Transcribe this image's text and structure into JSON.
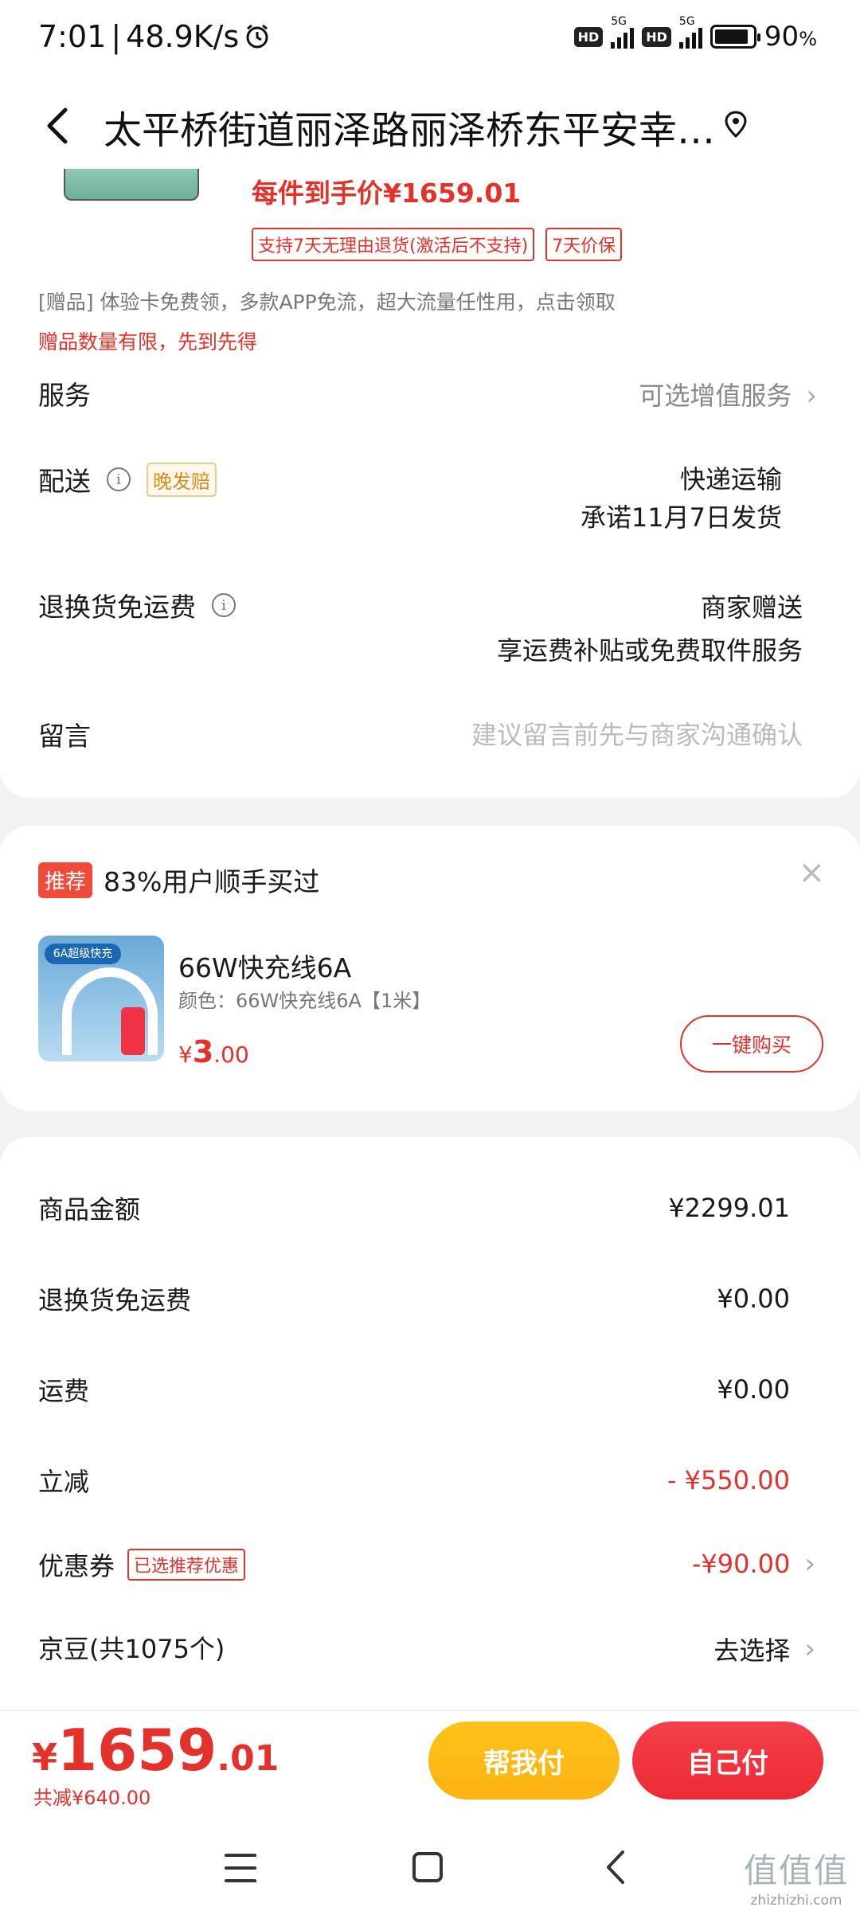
{
  "status_bar": {
    "time": "7:01",
    "speed": "48.9K/s",
    "battery": "90",
    "battery_unit": "%",
    "network_1": "5G",
    "network_2": "5G",
    "hd": "HD",
    "battery_level": 0.9
  },
  "header": {
    "title": "太平桥街道丽泽路丽泽桥东平安幸…"
  },
  "product": {
    "unit_price": "每件到手价¥1659.01",
    "tags": [
      "支持7天无理由退货(激活后不支持)",
      "7天价保"
    ]
  },
  "gift": {
    "text": "[赠品]  体验卡免费领，多款APP免流，超大流量任性用，点击领取",
    "warning": "赠品数量有限，先到先得"
  },
  "rows": {
    "service": {
      "label": "服务",
      "value": "可选增值服务"
    },
    "delivery": {
      "label": "配送",
      "tag": "晚发赔",
      "value_1": "快递运输",
      "value_2": "承诺11月7日发货"
    },
    "return_fee": {
      "label": "退换货免运费",
      "value_1": "商家赠送",
      "value_2": "享运费补贴或免费取件服务"
    },
    "message": {
      "label": "留言",
      "placeholder": "建议留言前先与商家沟通确认"
    }
  },
  "recommend": {
    "badge": "推荐",
    "title": "83%用户顺手买过",
    "close": "×",
    "image_badge": "6A超级快充",
    "item_name": "66W快充线6A",
    "item_attr": "颜色：66W快充线6A【1米】",
    "price_currency": "¥",
    "price_int": "3",
    "price_dec": ".00",
    "buy_button": "一键购买"
  },
  "summary": {
    "items": [
      {
        "label": "商品金额",
        "value": "¥2299.01"
      },
      {
        "label": "退换货免运费",
        "value": "¥0.00"
      },
      {
        "label": "运费",
        "value": "¥0.00"
      },
      {
        "label": "立减",
        "value": "- ¥550.00"
      },
      {
        "label": "优惠券",
        "tag": "已选推荐优惠",
        "value": "-¥90.00"
      },
      {
        "label": "京豆(共1075个)",
        "value": "去选择"
      }
    ]
  },
  "footer": {
    "currency": "¥",
    "total_int": "1659",
    "total_dec": ".01",
    "saved": "共减¥640.00",
    "help_pay": "帮我付",
    "self_pay": "自己付"
  },
  "watermark": {
    "glyphs": "值值值",
    "url": "zhizhizhi.com"
  },
  "colors": {
    "accent_red": "#e4322b",
    "help_yellow": "#fbb313",
    "self_red": "#ec2a35"
  }
}
